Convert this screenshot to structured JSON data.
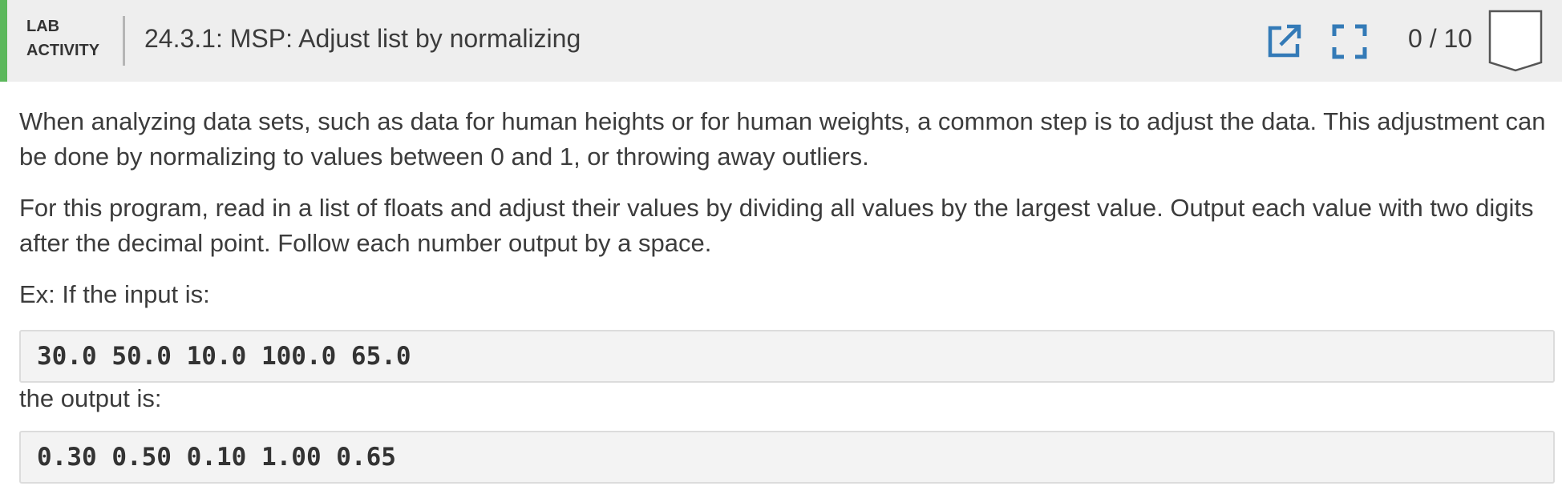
{
  "header": {
    "lab_label_line1": "LAB",
    "lab_label_line2": "ACTIVITY",
    "title": "24.3.1: MSP: Adjust list by normalizing",
    "score": "0 / 10",
    "open_icon": "open-in-new-icon",
    "fullscreen_icon": "fullscreen-icon",
    "accent_color": "#5cb85c",
    "icon_color": "#337ab7"
  },
  "content": {
    "paragraph1": "When analyzing data sets, such as data for human heights or for human weights, a common step is to adjust the data. This adjustment can be done by normalizing to values between 0 and 1, or throwing away outliers.",
    "paragraph2": "For this program, read in a list of floats and adjust their values by dividing all values by the largest value. Output each value with two digits after the decimal point. Follow each number output by a space.",
    "example_intro": "Ex: If the input is:",
    "example_input": "30.0 50.0 10.0 100.0 65.0",
    "output_intro": "the output is:",
    "example_output": "0.30 0.50 0.10 1.00 0.65"
  }
}
